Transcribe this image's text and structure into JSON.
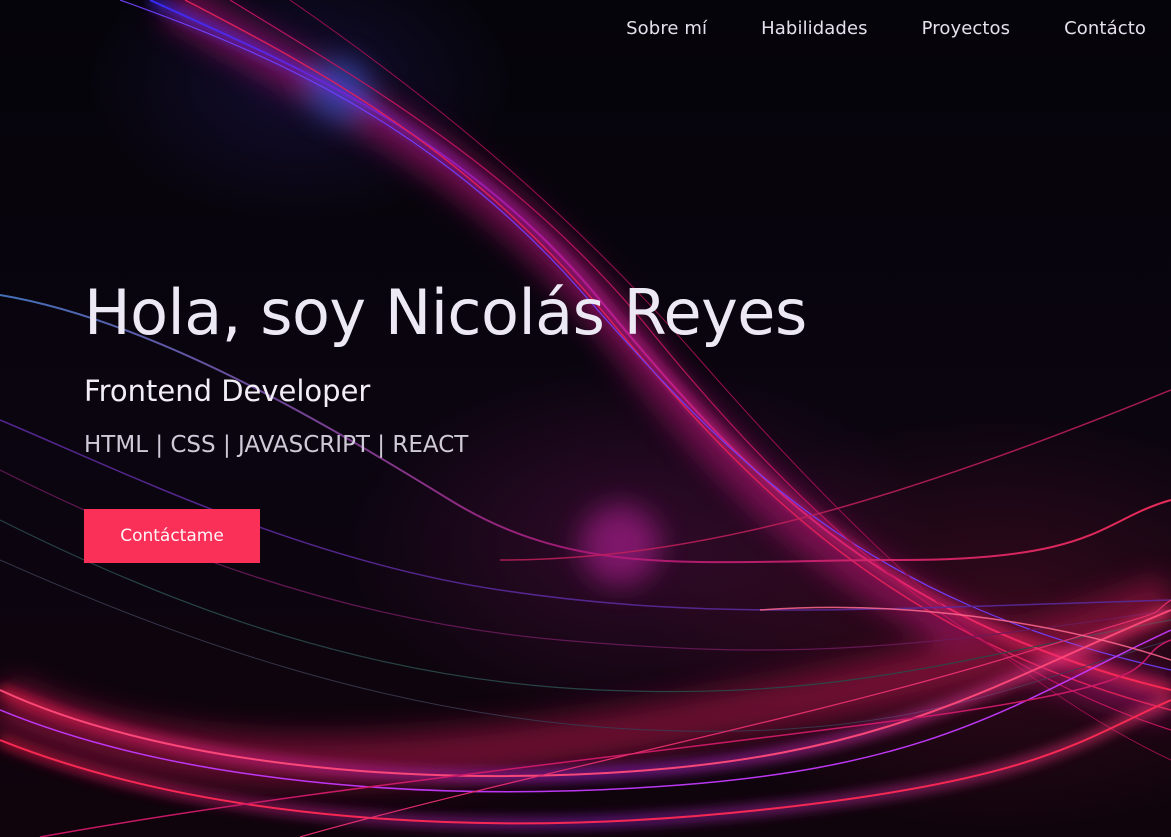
{
  "nav": {
    "items": [
      {
        "label": "Sobre mí"
      },
      {
        "label": "Habilidades"
      },
      {
        "label": "Proyectos"
      },
      {
        "label": "Contácto"
      }
    ]
  },
  "hero": {
    "title": "Hola, soy Nicolás Reyes",
    "role": "Frontend Developer",
    "skills": "HTML | CSS | JAVASCRIPT | REACT",
    "cta_label": "Contáctame"
  },
  "colors": {
    "accent": "#fb3059",
    "background": "#07040a",
    "text": "#ece8f4"
  }
}
